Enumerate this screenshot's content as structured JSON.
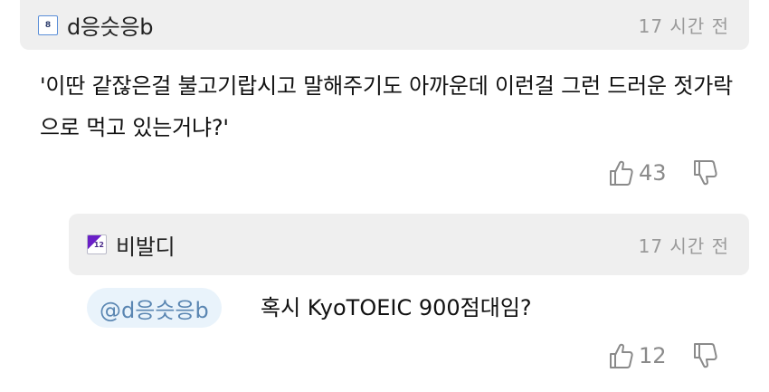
{
  "comment": {
    "username": "d응슷응b",
    "time": "17 시간 전",
    "badge_text": "8",
    "body": "'이딴 같잖은걸 불고기랍시고 말해주기도 아까운데 이런걸 그런 드러운 젓가락으로 먹고 있는거냐?'",
    "upvotes": "43"
  },
  "reply": {
    "username": "비발디",
    "time": "17 시간 전",
    "badge_text": "12",
    "mention": "@d응슷응b",
    "body": "혹시 KyoTOEIC 900점대임?",
    "upvotes": "12"
  },
  "colors": {
    "header_bg": "#efefef",
    "mention_bg": "#e9f3fb",
    "mention_text": "#5a86b2",
    "muted": "#9a9a9a"
  },
  "icons": [
    "thumbs-up-icon",
    "thumbs-down-icon",
    "level-badge-icon"
  ]
}
